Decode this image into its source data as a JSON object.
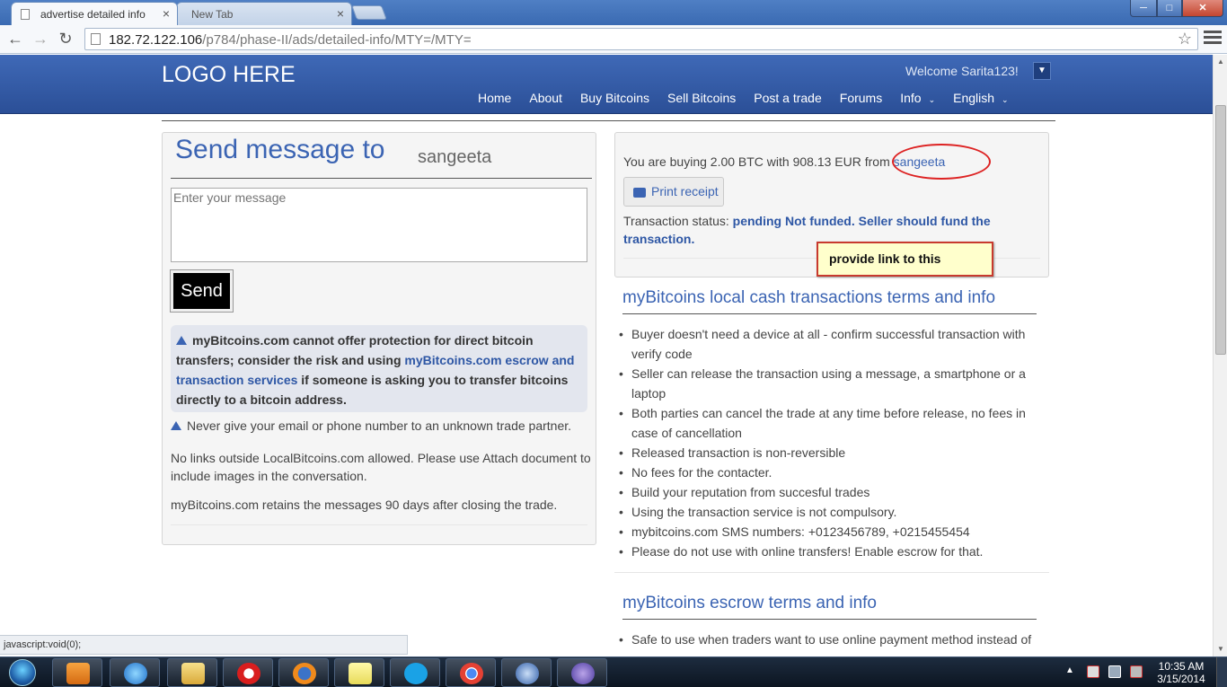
{
  "browser": {
    "tabs": [
      {
        "title": "advertise detailed info",
        "active": true
      },
      {
        "title": "New Tab",
        "active": false
      }
    ],
    "tab_close_glyph": "×",
    "window_buttons": {
      "minimize": "─",
      "maximize": "□",
      "close": "✕"
    },
    "nav": {
      "back": "←",
      "forward": "→",
      "reload": "↻"
    },
    "address": {
      "host": "182.72.122.106",
      "path": "/p784/phase-II/ads/detailed-info/MTY=/MTY="
    },
    "bookmark_star": "☆",
    "status_url": "javascript:void(0);"
  },
  "header": {
    "logo": "LOGO HERE",
    "welcome": "Welcome Sarita123!",
    "caret": "▼",
    "nav": [
      "Home",
      "About",
      "Buy Bitcoins",
      "Sell Bitcoins",
      "Post a trade",
      "Forums",
      "Info",
      "English"
    ],
    "nav_caret": "⌄"
  },
  "message": {
    "title": "Send message to",
    "username": "sangeeta",
    "placeholder": "Enter your message",
    "send_label": "Send",
    "warning_prefix": "myBitcoins.com cannot offer protection for direct bitcoin transfers; consider the risk and using ",
    "warning_link": "myBitcoins.com escrow and transaction services",
    "warning_suffix": " if someone is asking you to transfer bitcoins directly to a bitcoin address.",
    "tip_email": "Never give your email or phone number to an unknown trade partner.",
    "tip_links": "No links outside LocalBitcoins.com allowed. Please use Attach document to include images in the conversation.",
    "tip_retain": "myBitcoins.com retains the messages 90 days after closing the trade."
  },
  "trade": {
    "buy_text": "You are buying 2.00 BTC with 908.13 EUR from ",
    "seller": "sangeeta",
    "print_label": "Print receipt",
    "status_label": "Transaction status: ",
    "status_value": "pending Not funded. Seller should fund the transaction.",
    "annotation": "provide link to this"
  },
  "terms": {
    "title": "myBitcoins local cash transactions terms and info",
    "items": [
      "Buyer doesn't need a device at all - confirm successful transaction with verify code",
      "Seller can release the transaction using a message, a smartphone or a laptop",
      "Both parties can cancel the trade at any time before release, no fees in case of cancellation",
      "Released transaction is non-reversible",
      "No fees for the contacter.",
      "Build your reputation from succesful trades",
      "Using the transaction service is not compulsory.",
      "mybitcoins.com SMS numbers: +0123456789, +0215455454",
      "Please do not use with online transfers! Enable escrow for that."
    ]
  },
  "escrow": {
    "title": "myBitcoins escrow terms and info",
    "items": [
      "Safe to use when traders want to use online payment method instead of"
    ]
  },
  "taskbar": {
    "time": "10:35 AM",
    "date": "3/15/2014",
    "tray_arrow": "▲",
    "apps": [
      "media-player",
      "internet-explorer",
      "file-explorer",
      "opera",
      "firefox",
      "sticky-notes",
      "skype",
      "chrome",
      "thunderbird",
      "app-swirl"
    ]
  },
  "colors": {
    "header_blue": "#3f69b7",
    "link_blue": "#3b64b3",
    "annotation_red": "#d22",
    "note_yellow": "#ffffcc"
  }
}
